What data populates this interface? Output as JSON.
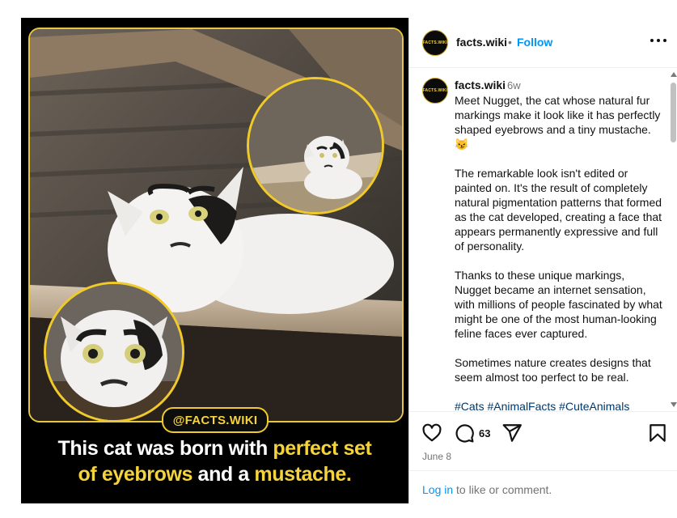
{
  "media": {
    "handle": "@FACTS.WIKI",
    "caption": {
      "line1_plain": "This cat was born with ",
      "line1_highlight": "perfect set",
      "line2_highlight_a": "of eyebrows",
      "line2_plain": " and a ",
      "line2_highlight_b": "mustache."
    },
    "colors": {
      "accent": "#f4d33c",
      "background": "#000000"
    }
  },
  "header": {
    "avatar_text": "FACTS.WIKI",
    "username": "facts.wiki",
    "separator": "•",
    "follow_label": "Follow"
  },
  "post": {
    "avatar_text": "FACTS.WIKI",
    "username": "facts.wiki",
    "time": "6w",
    "paragraphs": [
      "Meet Nugget, the cat whose natural fur markings make it look like it has perfectly shaped eyebrows and a tiny mustache. 😼",
      "The remarkable look isn't edited or painted on. It's the result of completely natural pigmentation patterns that formed as the cat developed, creating a face that appears permanently expressive and full of personality.",
      "Thanks to these unique markings, Nugget became an internet sensation, with millions of people fascinated by what might be one of the most human-looking feline faces ever captured.",
      "Sometimes nature creates designs that seem almost too perfect to be real."
    ],
    "hashtags": [
      "#Cats",
      "#AnimalFacts",
      "#CuteAnimals"
    ]
  },
  "actions": {
    "icons": [
      "heart-icon",
      "comment-icon",
      "share-icon",
      "bookmark-icon"
    ],
    "comment_count": "63",
    "date": "June 8",
    "login_link": "Log in",
    "login_suffix": " to like or comment."
  }
}
